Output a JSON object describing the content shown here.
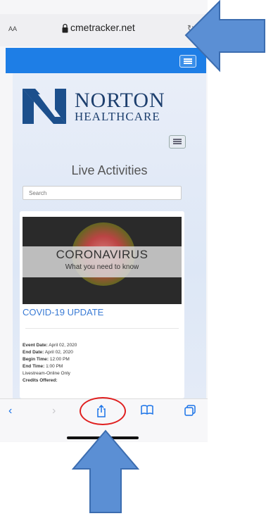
{
  "browser": {
    "text_size_label": "AA",
    "domain": "cmetracker.net"
  },
  "site": {
    "brand_line1": "NORTON",
    "brand_line2": "HEALTHCARE",
    "page_title": "Live Activities",
    "search_placeholder": "Search"
  },
  "card": {
    "banner_title": "CORONAVIRUS",
    "banner_subtitle": "What you need to know",
    "event_title": "COVID-19 UPDATE",
    "details": [
      {
        "label": "Event Date:",
        "value": "April 02, 2020"
      },
      {
        "label": "End Date:",
        "value": "April 02, 2020"
      },
      {
        "label": "Begin Time:",
        "value": "12:00 PM"
      },
      {
        "label": "End Time:",
        "value": "1:00 PM"
      },
      {
        "label": "",
        "value": "Livestream-Online Only"
      },
      {
        "label": "Credits Offered:",
        "value": ""
      }
    ]
  },
  "toolbar": {
    "icons": [
      "back-icon",
      "forward-icon",
      "share-icon",
      "bookmarks-icon",
      "tabs-icon"
    ]
  },
  "colors": {
    "accent": "#1e7ee6",
    "annotation_arrow": "#5b8fd4",
    "annotation_circle": "#e02020"
  }
}
